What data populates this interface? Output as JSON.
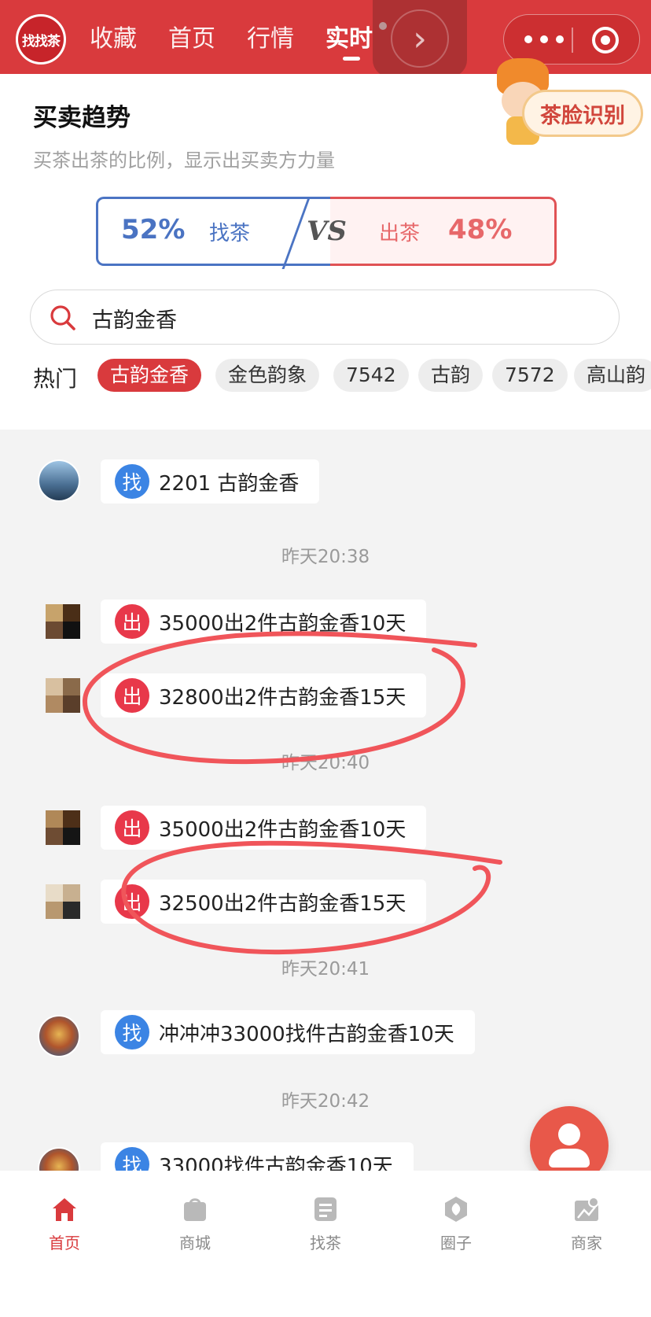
{
  "header": {
    "logo_text": "找找茶",
    "tabs": [
      "收藏",
      "首页",
      "行情",
      "实时"
    ],
    "active_tab": "实时"
  },
  "trend": {
    "title": "买卖趋势",
    "subtitle": "买茶出茶的比例，显示出买卖方力量",
    "face_button": "茶脸识别",
    "buy_percent": "52%",
    "buy_label": "找茶",
    "vs": "VS",
    "sell_label": "出茶",
    "sell_percent": "48%"
  },
  "search": {
    "value": "古韵金香"
  },
  "hot": {
    "label": "热门",
    "chips": [
      "古韵金香",
      "金色韵象",
      "7542",
      "古韵",
      "7572",
      "高山韵"
    ]
  },
  "feed": {
    "messages": [
      {
        "tag": "找",
        "text": "2201 古韵金香"
      },
      {
        "tag": "出",
        "text": "35000出2件古韵金香10天"
      },
      {
        "tag": "出",
        "text": "32800出2件古韵金香15天"
      },
      {
        "tag": "出",
        "text": "35000出2件古韵金香10天"
      },
      {
        "tag": "出",
        "text": "32500出2件古韵金香15天"
      },
      {
        "tag": "找",
        "text": "冲冲冲33000找件古韵金香10天"
      },
      {
        "tag": "找",
        "text": "33000找件古韵金香10天"
      }
    ],
    "times": [
      "昨天20:38",
      "昨天20:40",
      "昨天20:41",
      "昨天20:42"
    ]
  },
  "tabbar": {
    "items": [
      "首页",
      "商城",
      "找茶",
      "圈子",
      "商家"
    ],
    "active": "首页"
  },
  "colors": {
    "brand_red": "#d93a3d",
    "buy_blue": "#4a73c2",
    "sell_red": "#e7686a",
    "find_tag": "#3b84e4",
    "sell_tag": "#e8384a"
  }
}
